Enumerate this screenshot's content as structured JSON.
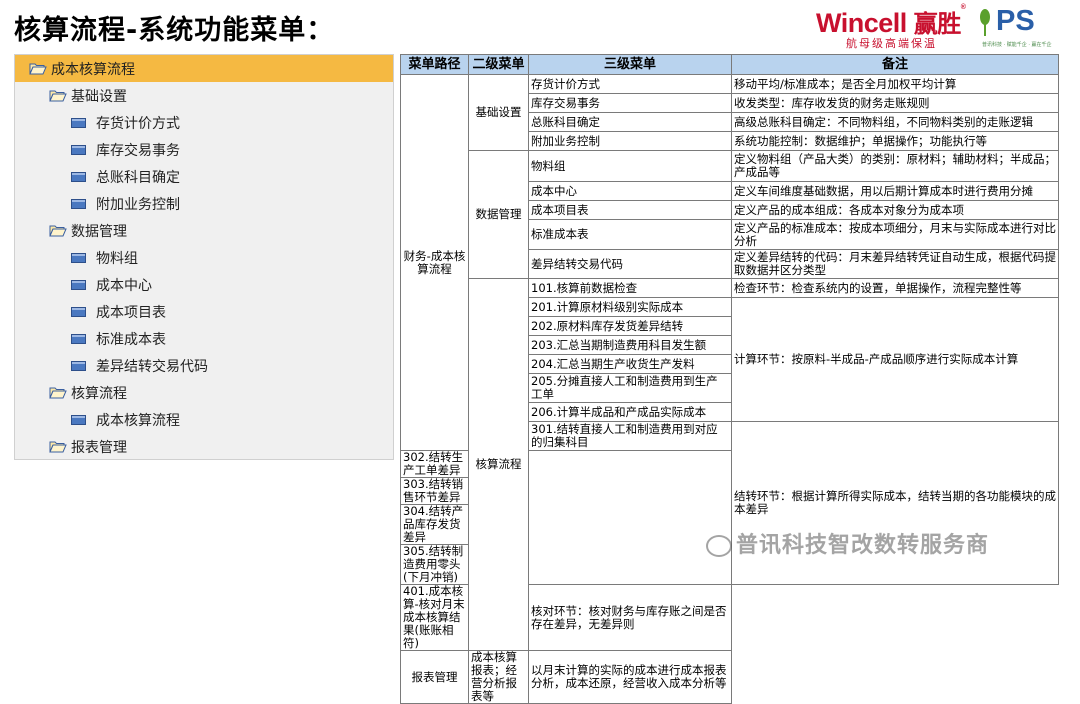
{
  "title": "核算流程-系统功能菜单：",
  "logo": {
    "brand": "Wincell",
    "brand_cn": "赢胜",
    "slogan": "航母级高端保温",
    "ps": "PS",
    "ps_sub": "普讯科技 · 赋能千企 · 赢在千企"
  },
  "tree": [
    {
      "label": "成本核算流程",
      "level": 0,
      "icon": "folder-open-icon",
      "selected": true
    },
    {
      "label": "基础设置",
      "level": 1,
      "icon": "folder-open-icon",
      "selected": false
    },
    {
      "label": "存货计价方式",
      "level": 2,
      "icon": "document-icon",
      "selected": false
    },
    {
      "label": "库存交易事务",
      "level": 2,
      "icon": "document-icon",
      "selected": false
    },
    {
      "label": "总账科目确定",
      "level": 2,
      "icon": "document-icon",
      "selected": false
    },
    {
      "label": "附加业务控制",
      "level": 2,
      "icon": "document-icon",
      "selected": false
    },
    {
      "label": "数据管理",
      "level": 1,
      "icon": "folder-open-icon",
      "selected": false
    },
    {
      "label": "物料组",
      "level": 2,
      "icon": "document-icon",
      "selected": false
    },
    {
      "label": "成本中心",
      "level": 2,
      "icon": "document-icon",
      "selected": false
    },
    {
      "label": "成本项目表",
      "level": 2,
      "icon": "document-icon",
      "selected": false
    },
    {
      "label": "标准成本表",
      "level": 2,
      "icon": "document-icon",
      "selected": false
    },
    {
      "label": "差异结转交易代码",
      "level": 2,
      "icon": "document-icon",
      "selected": false
    },
    {
      "label": "核算流程",
      "level": 1,
      "icon": "folder-open-icon",
      "selected": false
    },
    {
      "label": "成本核算流程",
      "level": 2,
      "icon": "document-icon",
      "selected": false
    },
    {
      "label": "报表管理",
      "level": 1,
      "icon": "folder-open-icon",
      "selected": false
    }
  ],
  "table": {
    "headers": [
      "菜单路径",
      "二级菜单",
      "三级菜单",
      "备注"
    ],
    "path": "财务-成本核算流程",
    "groups": {
      "basic": "基础设置",
      "data": "数据管理",
      "calc": "核算流程",
      "report": "报表管理"
    },
    "basic_rows": [
      {
        "menu": "存货计价方式",
        "note": "移动平均/标准成本；是否全月加权平均计算"
      },
      {
        "menu": "库存交易事务",
        "note": "收发类型：库存收发货的财务走账规则"
      },
      {
        "menu": "总账科目确定",
        "note": "高级总账科目确定：不同物料组，不同物料类别的走账逻辑"
      },
      {
        "menu": "附加业务控制",
        "note": "系统功能控制：数据维护；单据操作；功能执行等"
      }
    ],
    "data_rows": [
      {
        "menu": "物料组",
        "note": "定义物料组（产品大类）的类别：原材料；辅助材料；半成品；产成品等"
      },
      {
        "menu": "成本中心",
        "note": "定义车间维度基础数据，用以后期计算成本时进行费用分摊"
      },
      {
        "menu": "成本项目表",
        "note": "定义产品的成本组成：各成本对象分为成本项"
      },
      {
        "menu": "标准成本表",
        "note": "定义产品的标准成本：按成本项细分，月末与实际成本进行对比分析"
      },
      {
        "menu": "差异结转交易代码",
        "note": "定义差异结转的代码：月末差异结转凭证自动生成，根据代码提取数据并区分类型"
      }
    ],
    "calc_rows": [
      "101.核算前数据检查",
      "201.计算原材料级别实际成本",
      "202.原材料库存发货差异结转",
      "203.汇总当期制造费用科目发生额",
      "204.汇总当期生产收货生产发料",
      "205.分摊直接人工和制造费用到生产工单",
      "206.计算半成品和产成品实际成本",
      "301.结转直接人工和制造费用到对应的归集科目",
      "302.结转生产工单差异",
      "303.结转销售环节差异",
      "304.结转产品库存发货差异",
      "305.结转制造费用零头(下月冲销)",
      "401.成本核算-核对月末成本核算结果(账账相符)"
    ],
    "calc_notes": {
      "check": "检查环节：检查系统内的设置，单据操作，流程完整性等",
      "compute": "计算环节：按原料-半成品-产成品顺序进行实际成本计算",
      "carry": "结转环节：根据计算所得实际成本，结转当期的各功能模块的成本差异",
      "verify": "核对环节：核对财务与库存账之间是否存在差异，无差异则"
    },
    "report_row": {
      "menu": "成本核算报表；经营分析报表等",
      "note": "以月末计算的实际的成本进行成本报表分析，成本还原，经营收入成本分析等"
    }
  },
  "watermark": "普讯科技智改数转服务商"
}
